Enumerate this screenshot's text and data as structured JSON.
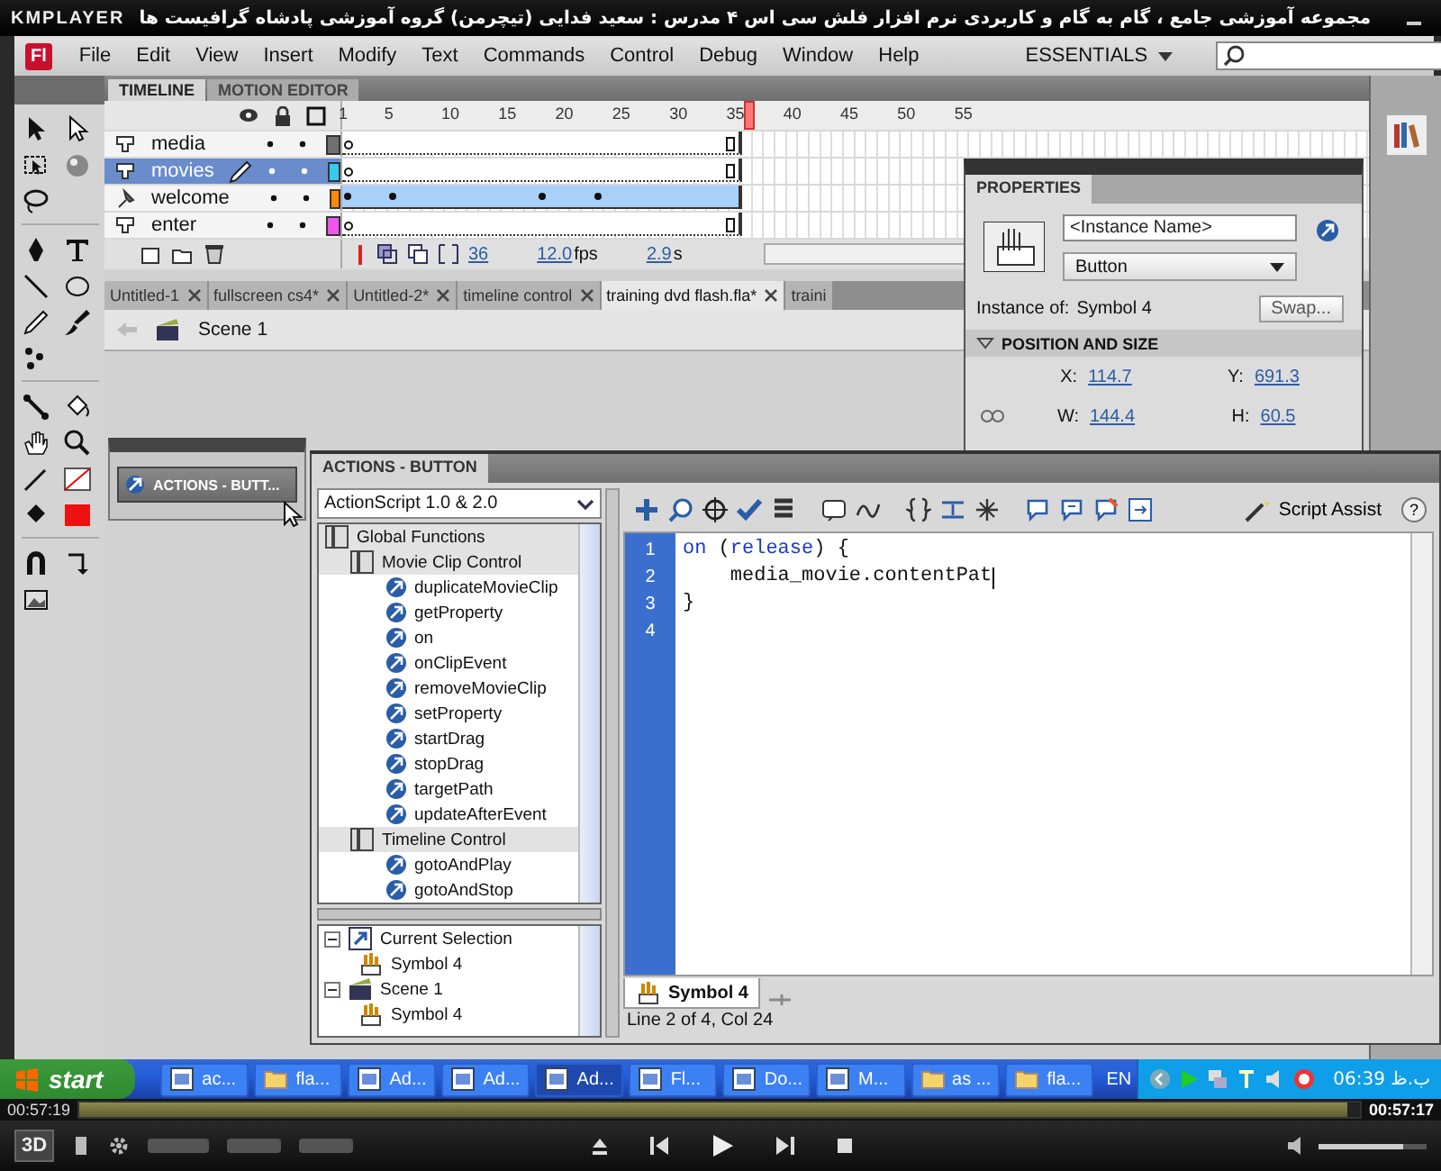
{
  "player": {
    "logo": "KMPLAYER",
    "title": "مجموعه آموزشی جامع ، گام به گام و کاربردی نرم افزار فلش سی اس ۴ مدرس : سعید فدایی (تیچرمن) گروه آموزشی پادشاه گرافیست ها"
  },
  "app": {
    "logo": "Fl",
    "menu": [
      "File",
      "Edit",
      "View",
      "Insert",
      "Modify",
      "Text",
      "Commands",
      "Control",
      "Debug",
      "Window",
      "Help"
    ],
    "workspace": "ESSENTIALS"
  },
  "timeline": {
    "tabs": [
      {
        "label": "TIMELINE",
        "selected": true
      },
      {
        "label": "MOTION EDITOR",
        "selected": false
      }
    ],
    "ruler": [
      "1",
      "5",
      "10",
      "15",
      "20",
      "25",
      "30",
      "35",
      "40",
      "45",
      "50",
      "55"
    ],
    "layers": [
      {
        "name": "media",
        "kind": "normal",
        "selected": false,
        "editing": false,
        "color": "#707070"
      },
      {
        "name": "movies",
        "kind": "normal",
        "selected": true,
        "editing": true,
        "color": "#33ccee"
      },
      {
        "name": "welcome",
        "kind": "tween",
        "selected": false,
        "editing": false,
        "color": "#ff8800"
      },
      {
        "name": "enter",
        "kind": "normal",
        "selected": false,
        "editing": false,
        "color": "#ee55ee"
      }
    ],
    "status": {
      "frame": "36",
      "fps": "12.0",
      "fps_unit": "fps",
      "time": "2.9",
      "time_unit": "s"
    }
  },
  "doc_tabs": [
    {
      "label": "Untitled-1",
      "selected": false
    },
    {
      "label": "fullscreen cs4*",
      "selected": false
    },
    {
      "label": "Untitled-2*",
      "selected": false
    },
    {
      "label": "timeline control",
      "selected": false
    },
    {
      "label": "training dvd flash.fla*",
      "selected": true
    },
    {
      "label": "traini",
      "selected": false
    }
  ],
  "scene": "Scene 1",
  "collapsed_panel": {
    "label": "ACTIONS - BUTT..."
  },
  "properties": {
    "title": "PROPERTIES",
    "instance_name": {
      "placeholder": "<Instance Name>"
    },
    "type": "Button",
    "instance_of_label": "Instance of:",
    "instance_of": "Symbol 4",
    "swap": "Swap...",
    "section": "POSITION AND SIZE",
    "fields": [
      {
        "label": "X:",
        "value": "114.7"
      },
      {
        "label": "Y:",
        "value": "691.3"
      },
      {
        "label": "W:",
        "value": "144.4"
      },
      {
        "label": "H:",
        "value": "60.5"
      }
    ]
  },
  "actions": {
    "title": "ACTIONS - BUTTON",
    "language": "ActionScript 1.0 & 2.0",
    "script_assist": "Script Assist",
    "help": "?",
    "toolbox": [
      {
        "label": "Global Functions",
        "kind": "book",
        "children": [
          {
            "label": "Movie Clip Control",
            "kind": "book",
            "children": [
              {
                "label": "duplicateMovieClip",
                "kind": "function"
              },
              {
                "label": "getProperty",
                "kind": "function"
              },
              {
                "label": "on",
                "kind": "function"
              },
              {
                "label": "onClipEvent",
                "kind": "function"
              },
              {
                "label": "removeMovieClip",
                "kind": "function"
              },
              {
                "label": "setProperty",
                "kind": "function"
              },
              {
                "label": "startDrag",
                "kind": "function"
              },
              {
                "label": "stopDrag",
                "kind": "function"
              },
              {
                "label": "targetPath",
                "kind": "function"
              },
              {
                "label": "updateAfterEvent",
                "kind": "function"
              }
            ]
          },
          {
            "label": "Timeline Control",
            "kind": "book",
            "children": [
              {
                "label": "gotoAndPlay",
                "kind": "function"
              },
              {
                "label": "gotoAndStop",
                "kind": "function"
              }
            ]
          }
        ]
      }
    ],
    "script_nav": [
      {
        "label": "Current Selection",
        "kind": "selection",
        "expanded": true,
        "children": [
          {
            "label": "Symbol 4",
            "kind": "symbol"
          }
        ]
      },
      {
        "label": "Scene 1",
        "kind": "scene",
        "expanded": true,
        "children": [
          {
            "label": "Symbol 4",
            "kind": "symbol"
          }
        ]
      }
    ],
    "lines": [
      {
        "number": "1",
        "tokens": [
          {
            "text": "on",
            "kind": "keyword"
          },
          {
            "text": " (",
            "kind": "plain"
          },
          {
            "text": "release",
            "kind": "keyword"
          },
          {
            "text": ") {",
            "kind": "plain"
          }
        ]
      },
      {
        "number": "2",
        "cursor": true,
        "tokens": [
          {
            "text": "    media_movie.contentPat",
            "kind": "plain"
          }
        ]
      },
      {
        "number": "3",
        "tokens": [
          {
            "text": "}",
            "kind": "plain"
          }
        ]
      },
      {
        "number": "4"
      }
    ],
    "file_tab": "Symbol 4",
    "status": "Line 2 of 4, Col 24"
  },
  "taskbar": {
    "start": "start",
    "items": [
      {
        "label": "ac...",
        "kind": "app",
        "selected": false
      },
      {
        "label": "fla...",
        "kind": "folder",
        "selected": false
      },
      {
        "label": "Ad...",
        "kind": "app",
        "selected": false
      },
      {
        "label": "Ad...",
        "kind": "app",
        "selected": false
      },
      {
        "label": "Ad...",
        "kind": "app",
        "selected": true
      },
      {
        "label": "Fl...",
        "kind": "app",
        "selected": false
      },
      {
        "label": "Do...",
        "kind": "app",
        "selected": false
      },
      {
        "label": "M...",
        "kind": "app",
        "selected": false
      },
      {
        "label": "as ...",
        "kind": "folder",
        "selected": false
      },
      {
        "label": "fla...",
        "kind": "folder",
        "selected": false
      }
    ],
    "language": "EN",
    "clock": "06:39 ب.ظ"
  },
  "playback": {
    "elapsed": "00:57:19",
    "total": "00:57:17",
    "level": 0.99,
    "mode": "3D",
    "volume": {
      "level": 0.78
    }
  }
}
